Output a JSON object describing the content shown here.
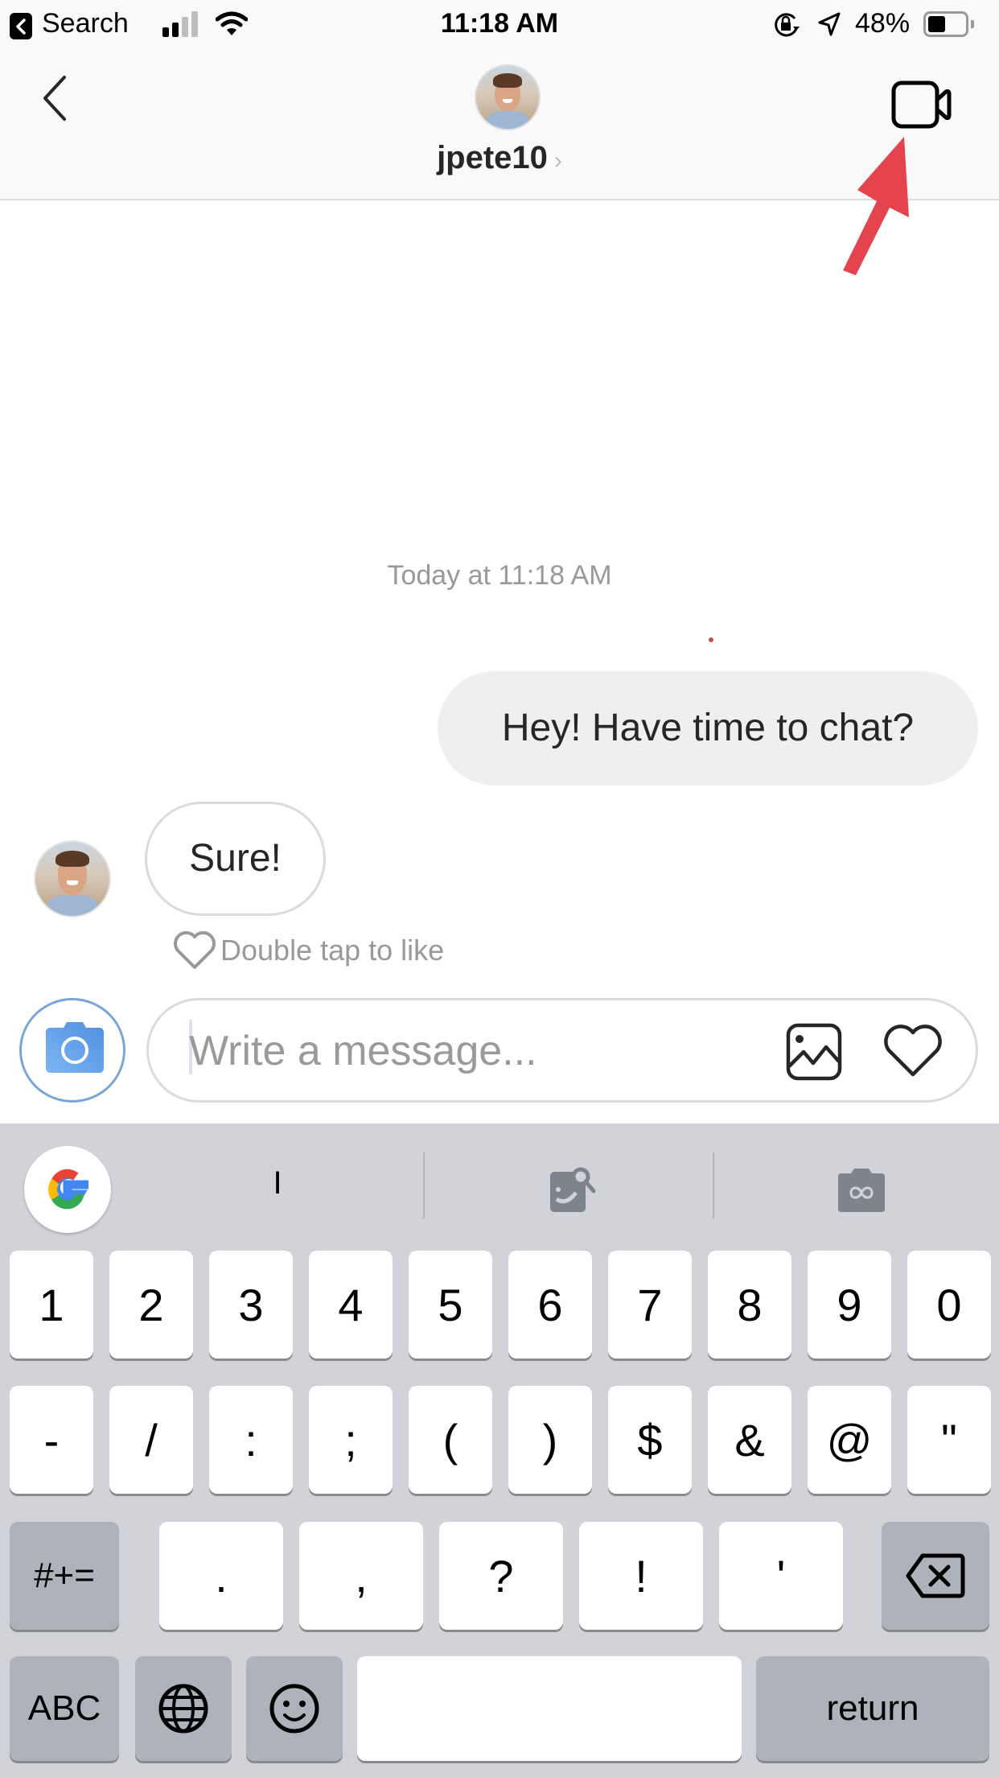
{
  "status_bar": {
    "back_app_label": "Search",
    "time": "11:18 AM",
    "battery_percent_label": "48%",
    "battery_level": 0.48,
    "signal_bars_filled": 2,
    "signal_bars_total": 4,
    "icons": [
      "back-badge-icon",
      "signal-icon",
      "wifi-icon",
      "orientation-lock-icon",
      "location-arrow-icon",
      "battery-icon"
    ]
  },
  "header": {
    "username": "jpete10",
    "chevron": "›",
    "back_icon": "chevron-left-icon",
    "video_call_icon": "video-camera-icon",
    "annotation": "red-arrow pointing to video call button"
  },
  "conversation": {
    "timestamp": "Today at 11:18 AM",
    "messages": [
      {
        "from": "me",
        "text": "Hey! Have time to chat?"
      },
      {
        "from": "jpete10",
        "text": "Sure!"
      }
    ],
    "like_hint": "Double tap to like"
  },
  "composer": {
    "placeholder": "Write a message...",
    "value": "",
    "camera_icon": "camera-icon",
    "gallery_icon": "image-icon",
    "like_icon": "heart-icon",
    "accent_color": "#5b9ae6"
  },
  "keyboard": {
    "suggestion": "I",
    "suggestion_icons": [
      "google-icon",
      "image-search-icon",
      "gif-camera-icon"
    ],
    "row1": [
      "1",
      "2",
      "3",
      "4",
      "5",
      "6",
      "7",
      "8",
      "9",
      "0"
    ],
    "row2": [
      "-",
      "/",
      ":",
      ";",
      "(",
      ")",
      "$",
      "&",
      "@",
      "\""
    ],
    "row3_left": "#+=",
    "row3": [
      ".",
      ",",
      "?",
      "!",
      "'"
    ],
    "row4": {
      "abc": "ABC",
      "space": "",
      "return": "return"
    }
  }
}
